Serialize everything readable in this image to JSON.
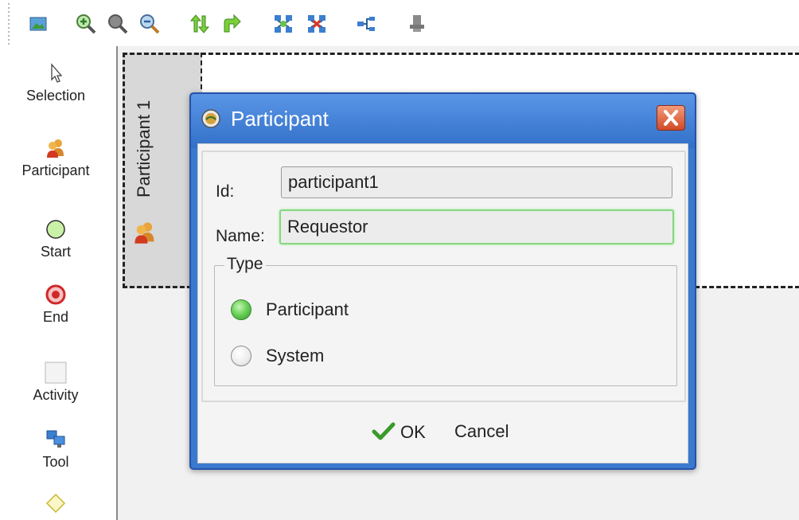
{
  "toolbar": {
    "icons": [
      "image-icon",
      "zoom-in-icon",
      "zoom-actual-icon",
      "zoom-out-icon",
      "swap-vertical-icon",
      "redo-arrow-icon",
      "layout-green-icon",
      "layout-red-icon",
      "connect-icon",
      "stamp-icon"
    ]
  },
  "palette": {
    "items": [
      {
        "label": "Selection",
        "icon": "cursor-icon"
      },
      {
        "label": "Participant",
        "icon": "people-icon"
      },
      {
        "label": "Start",
        "icon": "start-circle-icon"
      },
      {
        "label": "End",
        "icon": "end-circle-icon"
      },
      {
        "label": "Activity",
        "icon": "activity-box-icon"
      },
      {
        "label": "Tool",
        "icon": "tool-monitors-icon"
      },
      {
        "label": "",
        "icon": "diamond-icon"
      }
    ]
  },
  "canvas": {
    "lane_title": "Participant 1"
  },
  "dialog": {
    "title": "Participant",
    "id_label": "Id:",
    "id_value": "participant1",
    "name_label": "Name:",
    "name_value": "Requestor",
    "type_legend": "Type",
    "type_options": [
      {
        "label": "Participant",
        "selected": true
      },
      {
        "label": "System",
        "selected": false
      }
    ],
    "ok_label": "OK",
    "cancel_label": "Cancel"
  },
  "colors": {
    "title_bar": "#3b79cf",
    "close_button": "#d24a26",
    "selected_radio": "#6cd25a",
    "focus_border": "#84d87e"
  }
}
